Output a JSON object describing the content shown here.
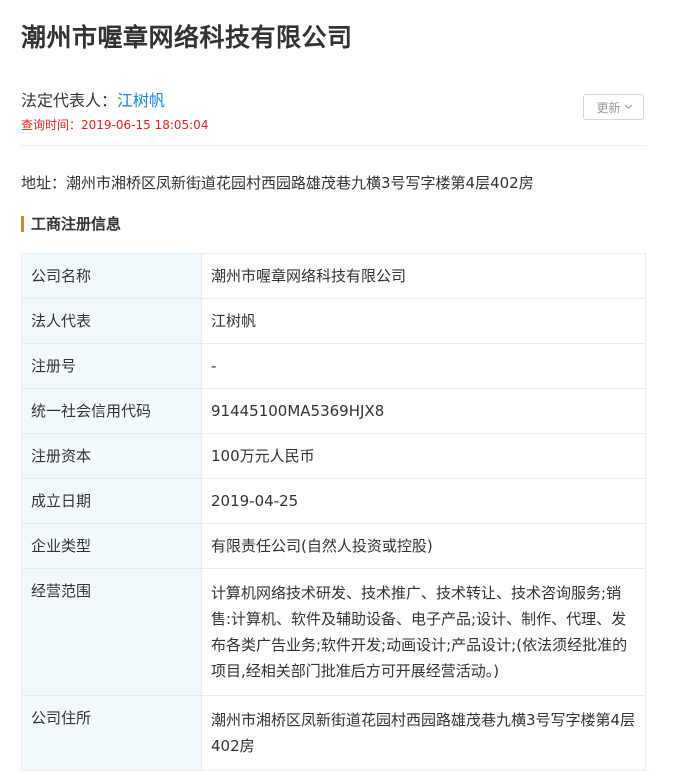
{
  "header": {
    "company_name": "潮州市喔章网络科技有限公司",
    "rep_label": "法定代表人：",
    "rep_name": "江树帆",
    "query_time": "查询时间：2019-06-15 18:05:04",
    "update_label": "更新"
  },
  "address": {
    "text": "地址：潮州市湘桥区凤新街道花园村西园路雄茂巷九横3号写字楼第4层402房"
  },
  "section": {
    "title": "工商注册信息"
  },
  "rows": [
    {
      "label": "公司名称",
      "value": "潮州市喔章网络科技有限公司"
    },
    {
      "label": "法人代表",
      "value": "江树帆"
    },
    {
      "label": "注册号",
      "value": "-"
    },
    {
      "label": "统一社会信用代码",
      "value": "91445100MA5369HJX8"
    },
    {
      "label": "注册资本",
      "value": "100万元人民币"
    },
    {
      "label": "成立日期",
      "value": "2019-04-25"
    },
    {
      "label": "企业类型",
      "value": "有限责任公司(自然人投资或控股)"
    },
    {
      "label": "经营范围",
      "value": "计算机网络技术研发、技术推广、技术转让、技术咨询服务;销售:计算机、软件及辅助设备、电子产品;设计、制作、代理、发布各类广告业务;软件开发;动画设计;产品设计;(依法须经批准的项目,经相关部门批准后方可开展经营活动。)"
    },
    {
      "label": "公司住所",
      "value": "潮州市湘桥区凤新街道花园村西园路雄茂巷九横3号写字楼第4层402房"
    }
  ],
  "colors": {
    "link": "#128bed",
    "query_time": "#e3271d",
    "section_bar": "#d9822b",
    "label_bg": "#f2f9fc"
  }
}
